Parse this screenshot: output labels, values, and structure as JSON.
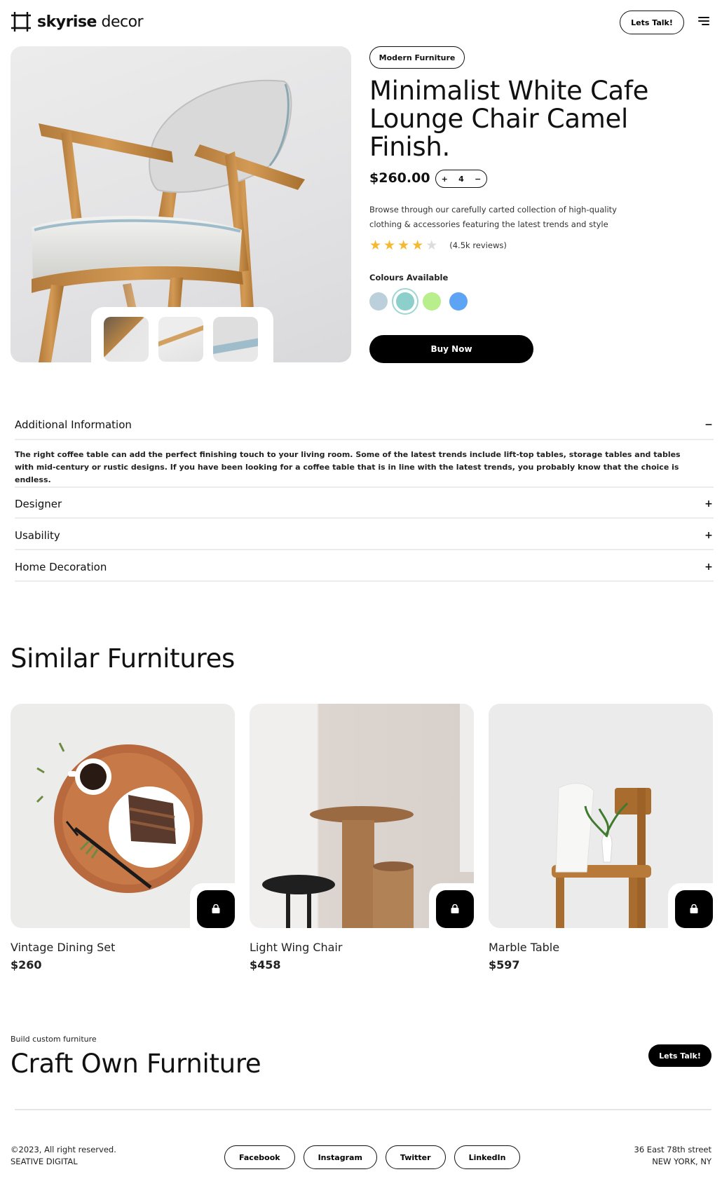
{
  "header": {
    "logo_bold": "skyrise",
    "logo_light": " decor",
    "cta_label": "Lets Talk!",
    "menu_icon": "hamburger-icon"
  },
  "product": {
    "tag": "Modern Furniture",
    "title": "Minimalist White Cafe Lounge Chair Camel Finish.",
    "price": "$260.00",
    "quantity": {
      "plus": "+",
      "value": "4",
      "minus": "−"
    },
    "description": "Browse through our carefully carted collection of high-quality clothing & accessories featuring the latest trends and style",
    "rating": {
      "stars": 4,
      "max": 5,
      "reviews": "(4.5k reviews)",
      "star_color": "#f5b82e",
      "empty_color": "#dcdcdc"
    },
    "colours_label": "Colours Available",
    "colours": [
      "#bcd0db",
      "#8ccfcb",
      "#b8ee8c",
      "#5ea4f5"
    ],
    "selected_colour_index": 1,
    "buy_label": "Buy Now"
  },
  "accordion": [
    {
      "title": "Additional Information",
      "sign": "−",
      "body": "The right coffee table can add the perfect finishing touch to your living room. Some of the latest trends include lift-top tables, storage tables and tables with mid-century or rustic designs. If you have been looking for a coffee table that is in line with the latest trends, you probably know that the choice is endless."
    },
    {
      "title": "Designer",
      "sign": "+"
    },
    {
      "title": "Usability",
      "sign": "+"
    },
    {
      "title": "Home Decoration",
      "sign": "+"
    }
  ],
  "similar": {
    "title": "Similar Furnitures",
    "items": [
      {
        "name": "Vintage Dining Set",
        "price": "$260"
      },
      {
        "name": "Light Wing Chair",
        "price": "$458"
      },
      {
        "name": "Marble Table",
        "price": "$597"
      }
    ]
  },
  "craft": {
    "subtitle": "Build custom furniture",
    "title": "Craft Own Furniture",
    "cta_label": "Lets Talk!"
  },
  "footer": {
    "copyright_line1": "©2023, All right reserved.",
    "copyright_line2": "SEATIVE DIGITAL",
    "socials": [
      "Facebook",
      "Instagram",
      "Twitter",
      "LinkedIn"
    ],
    "address_line1": "36 East 78th street",
    "address_line2": "NEW YORK, NY"
  }
}
